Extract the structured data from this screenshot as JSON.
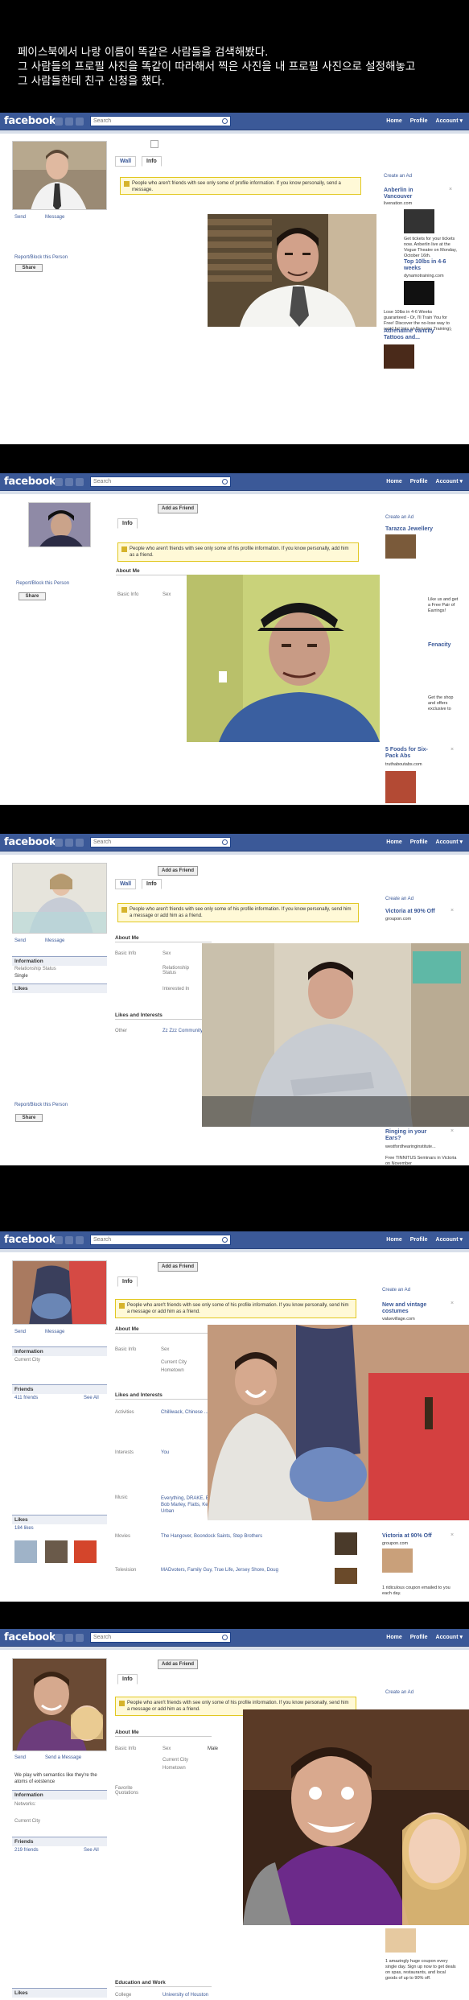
{
  "caption": {
    "line1": "페이스북에서 나랑 이름이 똑같은 사람들을 검색해봤다.",
    "line2": "그 사람들의 프로필 사진을 똑같이 따라해서 찍은 사진을 내 프로필 사진으로 설정해놓고",
    "line3": "그 사람들한테 친구 신청을 했다."
  },
  "fb": {
    "logo": "facebook",
    "search_placeholder": "Search",
    "nav_home": "Home",
    "nav_profile": "Profile",
    "nav_account": "Account ▾",
    "tab_wall": "Wall",
    "tab_info": "Info",
    "add_friend": "Add as Friend",
    "share": "Share",
    "send_message": "Send a Message",
    "send": "Send",
    "message": "Message",
    "report": "Report/Block this Person",
    "create_ad": "Create an Ad",
    "about_me": "About Me",
    "basic_info": "Basic Info",
    "sex": "Sex",
    "information": "Information",
    "likes_interests": "Likes and Interests",
    "likes": "Likes",
    "friends": "Friends",
    "see_all": "See All",
    "current_city": "Current City",
    "hometown": "Hometown",
    "networks": "Networks:",
    "relationship_status": "Relationship Status",
    "relationship_value": "Single",
    "interested_in": "Interested In",
    "other": "Other"
  },
  "panel1": {
    "notice": "People who aren't friends with          see only some of          profile information. If you know          personally, send a message.",
    "ads": [
      {
        "title": "Anberlin in Vancouver",
        "domain": "livenation.com",
        "text": "Get tickets for your tickets now. Anberlin live at the Vogue Theatre on Monday, October 16th."
      },
      {
        "title": "Top 10lbs in 4-6 weeks",
        "domain": "dynamotraining.com",
        "text": "Lose 10lbs in 4-6 Weeks guaranteed - Or, I'll Train You for Free! Discover the no-lose way to rapid fat loss w/ Dynamo Training!"
      },
      {
        "title": "Adrenaline Vancity Tattoos and...",
        "domain": "",
        "text": ""
      }
    ]
  },
  "panel2": {
    "notice": "People who aren't friends with          see only some of his profile information. If you know          personally, add him as a friend.",
    "ads": [
      {
        "title": "Tarazca Jewellery",
        "domain": "",
        "text": "Like us and get a Free Pair of Earrings!"
      },
      {
        "title": "Fenacity",
        "domain": "",
        "text": "Get the shop and offers exclusive to"
      },
      {
        "title": "5 Foods for Six-Pack Abs",
        "domain": "truthaboutabs.com",
        "text": ""
      }
    ]
  },
  "panel3": {
    "notice": "People who aren't friends with          see only some of his profile information. If you know          personally, send him a message or add him as a friend.",
    "other_value": "Zz Zzz Community",
    "ads": [
      {
        "title": "Victoria at 90% Off",
        "domain": "groupon.com",
        "text": ""
      },
      {
        "title": "Ringing in your Ears?",
        "domain": "westfordhearinginstitute...",
        "text": "Free TINNITUS Seminars in Victoria on November"
      }
    ]
  },
  "panel4": {
    "notice": "People who aren't friends with          see only some of his profile information. If you know          personally, send him a message or add him as a friend.",
    "friends_count": "411 friends",
    "likes_count": "184 likes",
    "activities": "Chilliwack, Chinese ...",
    "interests": "You",
    "music": "Everything, DRAKE, Eminem, Bob Marley, Flatts, Keith Urban",
    "movies": "The Hangover, Boondock Saints, Step Brothers",
    "television": "MADvoters, Family Guy, True Life, Jersey Shore, Doug",
    "activities_label": "Activities",
    "interests_label": "Interests",
    "music_label": "Music",
    "movies_label": "Movies",
    "television_label": "Television",
    "ads": [
      {
        "title": "New and vintage costumes",
        "domain": "valuevillage.com",
        "text": ""
      },
      {
        "title": "Victoria at 90% Off",
        "domain": "groupon.com",
        "text": "1 ridiculous coupon emailed to you each day."
      }
    ]
  },
  "panel5": {
    "notice": "People who aren't friends with          see only some of his profile information. If you know          personally, send him a message or add him as a friend.",
    "bio": "We play with semantics like they're the atoms of existence",
    "friends_count": "219 friends",
    "sex_value": "Male",
    "favorite_quotations": "Favorite Quotations",
    "education_work": "Education and Work",
    "college": "College",
    "college_value": "University of Houston",
    "ad_text": "1 amazingly huge coupon every single day. Sign up now to get deals on spas, restaurants, and local goods of up to 90% off."
  }
}
